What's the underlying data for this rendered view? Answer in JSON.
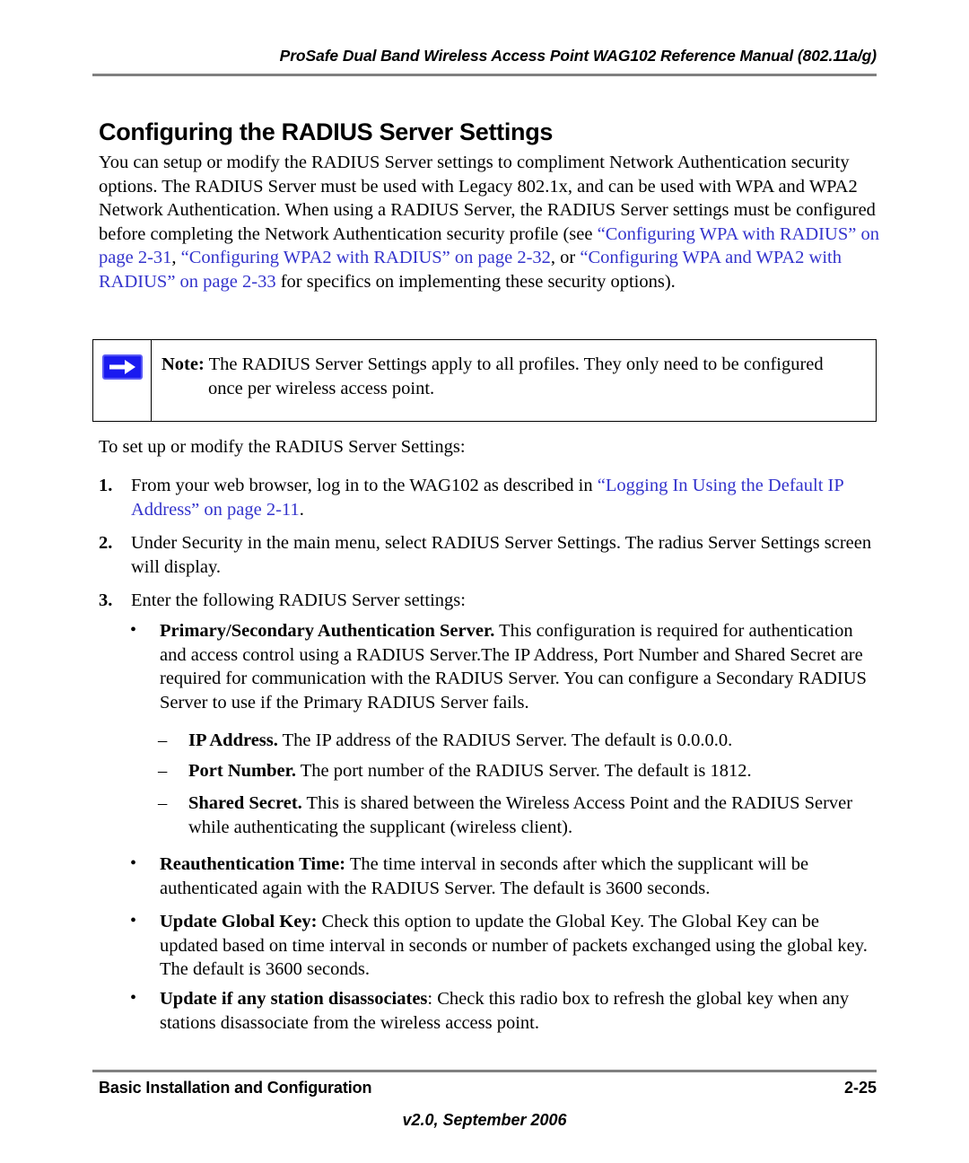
{
  "document": {
    "running_header": "ProSafe Dual Band Wireless Access Point WAG102 Reference Manual (802.11a/g)",
    "section_title": "Configuring the RADIUS Server Settings",
    "link_color": "#3333CC",
    "rule_color": "#808080"
  },
  "intro": {
    "part1": "You can setup or modify the RADIUS Server settings to compliment Network Authentication security options. The RADIUS Server must be used with Legacy 802.1x, and can be used with WPA and WPA2 Network Authentication. When using a RADIUS Server, the RADIUS Server settings must be configured before completing the Network Authentication security profile (see ",
    "link1": "“Configuring WPA with RADIUS” on page 2-31",
    "sep1": ", ",
    "link2": "“Configuring WPA2 with RADIUS” on page 2-32",
    "sep2": ", or ",
    "link3": "“Configuring WPA and WPA2 with RADIUS” on page 2-33",
    "part2": " for specifics on implementing these security options)."
  },
  "note": {
    "icon": "right-arrow-icon",
    "label": "Note:",
    "line1": " The RADIUS Server Settings apply to all profiles. They only need to be configured",
    "line2": "once per wireless access point."
  },
  "lead_in": "To set up or modify the RADIUS Server Settings:",
  "steps": [
    {
      "marker": "1.",
      "text_before": "From your web browser, log in to the WAG102 as described in ",
      "link": "“Logging In Using the Default IP Address” on page 2-11",
      "text_after": "."
    },
    {
      "marker": "2.",
      "text_before": "Under Security in the main menu, select RADIUS Server Settings. The radius Server Settings screen will display.",
      "link": "",
      "text_after": ""
    },
    {
      "marker": "3.",
      "text_before": "Enter the following RADIUS Server settings:",
      "link": "",
      "text_after": ""
    }
  ],
  "bullets": {
    "marker": "•",
    "primary": {
      "term": "Primary/Secondary Authentication Server.",
      "desc": " This configuration is required for authentication and access control using a RADIUS Server.The IP Address, Port Number and Shared Secret are required for communication with the RADIUS Server. You can configure a Secondary RADIUS Server to use if the Primary RADIUS Server fails."
    },
    "reauth": {
      "term": "Reauthentication Time:",
      "desc": " The time interval in seconds after which the supplicant will be authenticated again with the RADIUS Server. The default is 3600 seconds."
    },
    "global_key": {
      "term": "Update Global Key:",
      "desc": " Check this option to update the Global Key. The Global Key can be updated based on time interval in seconds or number of packets exchanged using the global key. The default is 3600 seconds."
    },
    "disassociates": {
      "term": "Update if any station disassociates",
      "desc": ": Check this radio box to refresh the global key when any stations disassociate from the wireless access point."
    }
  },
  "sub_bullets": {
    "marker": "–",
    "ip_address": {
      "term": "IP Address.",
      "desc": " The IP address of the RADIUS Server. The default is 0.0.0.0."
    },
    "port_number": {
      "term": "Port Number.",
      "desc": " The port number of the RADIUS Server. The default is 1812."
    },
    "shared_secret": {
      "term": "Shared Secret.",
      "desc": " This is shared between the Wireless Access Point and the RADIUS Server while authenticating the supplicant (wireless client)."
    }
  },
  "footer": {
    "left": "Basic Installation and Configuration",
    "page_number": "2-25",
    "version": "v2.0, September 2006"
  }
}
